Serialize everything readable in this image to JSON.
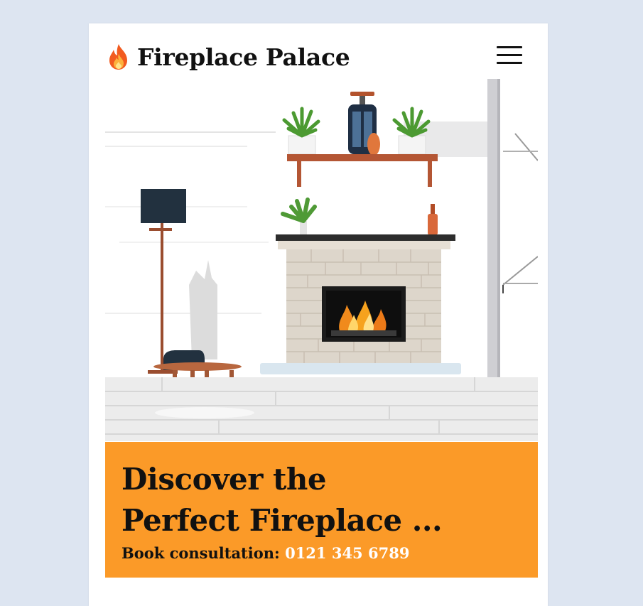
{
  "header": {
    "brand_icon": "fire-icon",
    "brand_name": "Fireplace Palace",
    "menu_icon": "hamburger-menu-icon"
  },
  "hero": {
    "image": "illustration-living-room-fireplace"
  },
  "promo": {
    "title_line1": "Discover the",
    "title_line2": "Perfect Fireplace ...",
    "consult_label": "Book consultation: ",
    "phone": "0121 345 6789"
  },
  "colors": {
    "background": "#dde5f1",
    "card": "#ffffff",
    "promo": "#fb9a28",
    "text": "#111111",
    "phone": "#ffffff"
  }
}
